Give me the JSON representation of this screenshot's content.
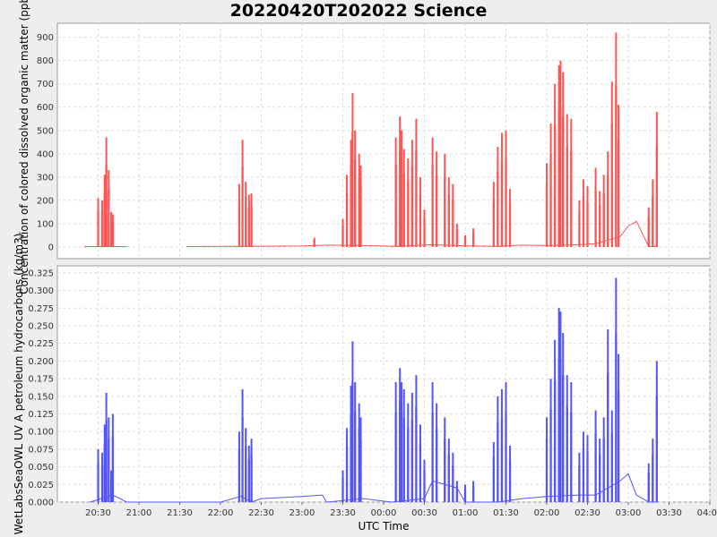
{
  "chart_data": {
    "type": "line",
    "title": "20220420T202022 Science",
    "xlabel": "UTC Time",
    "x_ticks": [
      "20:30",
      "21:00",
      "21:30",
      "22:00",
      "22:30",
      "23:00",
      "23:30",
      "00:00",
      "00:30",
      "01:00",
      "01:30",
      "02:00",
      "02:30",
      "03:00",
      "03:30",
      "04:00"
    ],
    "x_range_hours": [
      20.0,
      28.0
    ],
    "grid": true,
    "panels": [
      {
        "ylabel": "Concentration of colored dissolved organic matter (ppb)",
        "color": "#ff5555",
        "ylim": [
          -50,
          960
        ],
        "y_ticks": [
          0,
          100,
          200,
          300,
          400,
          500,
          600,
          700,
          800,
          900
        ],
        "y_tick_labels": [
          "0",
          "100",
          "200",
          "300",
          "400",
          "500",
          "600",
          "700",
          "800",
          "900"
        ],
        "baseline": [
          [
            20.33,
            2
          ],
          [
            20.85,
            2
          ],
          [
            21.25,
            null
          ],
          [
            21.58,
            2
          ],
          [
            22.3,
            3
          ],
          [
            23.0,
            4
          ],
          [
            23.33,
            8
          ],
          [
            23.75,
            6
          ],
          [
            24.17,
            3
          ],
          [
            24.6,
            10
          ],
          [
            25.0,
            5
          ],
          [
            25.4,
            3
          ],
          [
            25.7,
            8
          ],
          [
            26.0,
            6
          ],
          [
            26.4,
            10
          ],
          [
            26.6,
            14
          ],
          [
            26.9,
            45
          ],
          [
            27.0,
            90
          ],
          [
            27.1,
            110
          ],
          [
            27.25,
            2
          ],
          [
            27.35,
            3
          ]
        ],
        "spikes": [
          [
            20.5,
            210
          ],
          [
            20.55,
            200
          ],
          [
            20.58,
            310
          ],
          [
            20.6,
            470
          ],
          [
            20.63,
            330
          ],
          [
            20.66,
            150
          ],
          [
            20.68,
            140
          ],
          [
            22.23,
            270
          ],
          [
            22.27,
            460
          ],
          [
            22.31,
            280
          ],
          [
            22.35,
            225
          ],
          [
            22.38,
            230
          ],
          [
            23.15,
            40
          ],
          [
            23.5,
            120
          ],
          [
            23.55,
            310
          ],
          [
            23.6,
            460
          ],
          [
            23.62,
            660
          ],
          [
            23.65,
            500
          ],
          [
            23.7,
            400
          ],
          [
            23.72,
            350
          ],
          [
            24.15,
            470
          ],
          [
            24.2,
            560
          ],
          [
            24.22,
            500
          ],
          [
            24.25,
            420
          ],
          [
            24.3,
            380
          ],
          [
            24.35,
            460
          ],
          [
            24.4,
            550
          ],
          [
            24.45,
            300
          ],
          [
            24.5,
            160
          ],
          [
            24.6,
            470
          ],
          [
            24.65,
            410
          ],
          [
            24.75,
            400
          ],
          [
            24.8,
            300
          ],
          [
            24.85,
            270
          ],
          [
            24.9,
            100
          ],
          [
            25.0,
            50
          ],
          [
            25.1,
            80
          ],
          [
            25.35,
            280
          ],
          [
            25.4,
            430
          ],
          [
            25.45,
            490
          ],
          [
            25.5,
            500
          ],
          [
            25.55,
            250
          ],
          [
            26.0,
            360
          ],
          [
            26.05,
            530
          ],
          [
            26.1,
            700
          ],
          [
            26.15,
            780
          ],
          [
            26.17,
            800
          ],
          [
            26.2,
            750
          ],
          [
            26.25,
            570
          ],
          [
            26.3,
            550
          ],
          [
            26.4,
            200
          ],
          [
            26.45,
            290
          ],
          [
            26.5,
            260
          ],
          [
            26.6,
            340
          ],
          [
            26.65,
            240
          ],
          [
            26.7,
            310
          ],
          [
            26.75,
            410
          ],
          [
            26.8,
            710
          ],
          [
            26.85,
            920
          ],
          [
            26.88,
            610
          ],
          [
            27.25,
            170
          ],
          [
            27.3,
            290
          ],
          [
            27.35,
            580
          ]
        ]
      },
      {
        "ylabel": "WetLabsSeaOWL UV A petroleum hydrocarbons (kg/m3)",
        "color": "#5555ff",
        "ylim": [
          0.0,
          0.335
        ],
        "y_ticks": [
          0.0,
          0.025,
          0.05,
          0.075,
          0.1,
          0.125,
          0.15,
          0.175,
          0.2,
          0.225,
          0.25,
          0.275,
          0.3,
          0.325
        ],
        "y_tick_labels": [
          "0.000",
          "0.025",
          "0.050",
          "0.075",
          "0.100",
          "0.125",
          "0.150",
          "0.175",
          "0.200",
          "0.225",
          "0.250",
          "0.275",
          "0.300",
          "0.325"
        ],
        "baseline": [
          [
            20.4,
            0.0
          ],
          [
            20.68,
            0.01
          ],
          [
            20.85,
            0.0
          ],
          [
            22.0,
            0.0
          ],
          [
            22.25,
            0.008
          ],
          [
            22.38,
            0.0
          ],
          [
            22.5,
            0.005
          ],
          [
            23.0,
            0.008
          ],
          [
            23.25,
            0.01
          ],
          [
            23.3,
            0.0
          ],
          [
            23.75,
            0.005
          ],
          [
            24.1,
            0.0
          ],
          [
            24.5,
            0.005
          ],
          [
            24.6,
            0.03
          ],
          [
            24.9,
            0.02
          ],
          [
            25.0,
            0.0
          ],
          [
            25.4,
            0.0
          ],
          [
            25.7,
            0.005
          ],
          [
            26.0,
            0.008
          ],
          [
            26.4,
            0.01
          ],
          [
            26.6,
            0.01
          ],
          [
            26.9,
            0.03
          ],
          [
            27.0,
            0.04
          ],
          [
            27.1,
            0.01
          ],
          [
            27.25,
            0.0
          ],
          [
            27.35,
            0.0
          ]
        ],
        "spikes": [
          [
            20.5,
            0.075
          ],
          [
            20.55,
            0.07
          ],
          [
            20.58,
            0.11
          ],
          [
            20.6,
            0.155
          ],
          [
            20.63,
            0.12
          ],
          [
            20.66,
            0.045
          ],
          [
            20.68,
            0.125
          ],
          [
            22.23,
            0.1
          ],
          [
            22.27,
            0.16
          ],
          [
            22.31,
            0.105
          ],
          [
            22.35,
            0.08
          ],
          [
            22.38,
            0.09
          ],
          [
            23.5,
            0.045
          ],
          [
            23.55,
            0.105
          ],
          [
            23.6,
            0.165
          ],
          [
            23.62,
            0.228
          ],
          [
            23.65,
            0.17
          ],
          [
            23.7,
            0.14
          ],
          [
            23.72,
            0.12
          ],
          [
            24.15,
            0.17
          ],
          [
            24.2,
            0.19
          ],
          [
            24.22,
            0.17
          ],
          [
            24.25,
            0.16
          ],
          [
            24.3,
            0.14
          ],
          [
            24.35,
            0.155
          ],
          [
            24.4,
            0.18
          ],
          [
            24.45,
            0.11
          ],
          [
            24.5,
            0.06
          ],
          [
            24.6,
            0.17
          ],
          [
            24.65,
            0.14
          ],
          [
            24.75,
            0.12
          ],
          [
            24.8,
            0.09
          ],
          [
            24.85,
            0.07
          ],
          [
            24.9,
            0.03
          ],
          [
            25.0,
            0.025
          ],
          [
            25.1,
            0.03
          ],
          [
            25.35,
            0.085
          ],
          [
            25.4,
            0.15
          ],
          [
            25.45,
            0.16
          ],
          [
            25.5,
            0.17
          ],
          [
            25.55,
            0.08
          ],
          [
            26.0,
            0.12
          ],
          [
            26.05,
            0.175
          ],
          [
            26.1,
            0.23
          ],
          [
            26.15,
            0.275
          ],
          [
            26.17,
            0.27
          ],
          [
            26.2,
            0.24
          ],
          [
            26.25,
            0.18
          ],
          [
            26.3,
            0.17
          ],
          [
            26.4,
            0.07
          ],
          [
            26.45,
            0.1
          ],
          [
            26.5,
            0.095
          ],
          [
            26.6,
            0.13
          ],
          [
            26.65,
            0.09
          ],
          [
            26.7,
            0.12
          ],
          [
            26.75,
            0.245
          ],
          [
            26.8,
            0.13
          ],
          [
            26.85,
            0.318
          ],
          [
            26.88,
            0.21
          ],
          [
            27.25,
            0.055
          ],
          [
            27.3,
            0.09
          ],
          [
            27.35,
            0.2
          ]
        ]
      }
    ]
  }
}
